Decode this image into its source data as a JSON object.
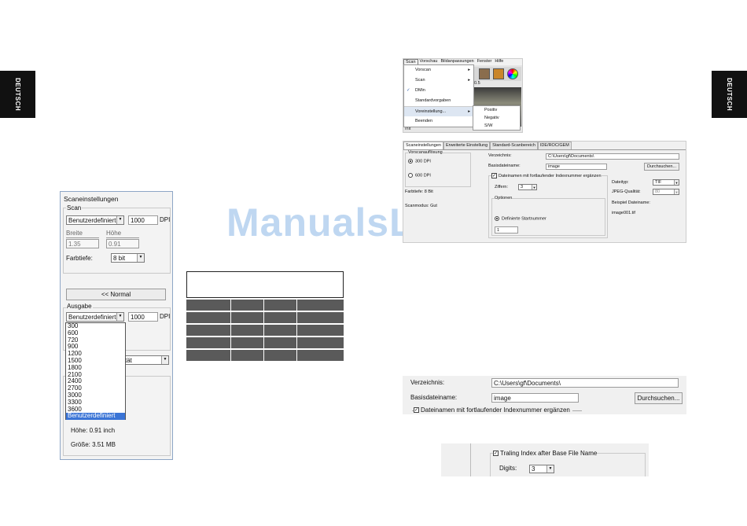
{
  "page": {
    "side_tab_label": "DEUTSCH",
    "watermark": "ManualsLib.de"
  },
  "scan_panel": {
    "title": "Scaneinstellungen",
    "scan_group": "Scan",
    "scan_res_select": "Benutzerdefiniert",
    "scan_res_value": "1000",
    "dpi": "DPI",
    "width_label": "Breite",
    "height_label": "Höhe",
    "width_value": "1.35",
    "height_value": "0.91",
    "depth_label": "Farbtiefe:",
    "depth_value": "8 bit",
    "normal_button": "<< Normal",
    "output_group": "Ausgabe",
    "out_res_select": "Benutzerdefiniert",
    "out_res_value": "1000",
    "quality_select_partial": "tät",
    "dropdown_options": [
      "300",
      "600",
      "720",
      "900",
      "1200",
      "1500",
      "1800",
      "2100",
      "2400",
      "2700",
      "3000",
      "3300",
      "3600",
      "Benutzerdefiniert"
    ],
    "selected_option": "Benutzerdefiniert",
    "size_height": "Höhe: 0.91 inch",
    "size_total": "Größe: 3.51 MB"
  },
  "menu_shot": {
    "menubar": [
      "Scan",
      "Vorschau",
      "Bildanpassungen",
      "Fenster",
      "Hilfe"
    ],
    "items": [
      "Vorscan",
      "Scan",
      "DMin",
      "Standardvorgaben",
      "Voreinstellung...",
      "Beenden"
    ],
    "submenu": [
      "Positiv",
      "Negativ",
      "S/W"
    ],
    "toolbar_value": "0.5",
    "status_text": "Init"
  },
  "settings_shot": {
    "tabs": [
      "Scaneinstellungen",
      "Erweiterte Einstellung",
      "Standard-Scanbereich",
      "IDE/ROC/GEM"
    ],
    "preview_res_label": "Vorscanauflösung",
    "radio_300": "300 DPI",
    "radio_600": "600 DPI",
    "depth_text": "Farbtiefe: 8 Bit",
    "scanmode_text": "Scanmodus: Gut",
    "folder_label": "Verzeichnis:",
    "folder_value": "C:\\Users\\gf\\Documents\\",
    "base_label": "Basisdateiname:",
    "base_value": "image",
    "browse_button": "Durchsuchen...",
    "index_checkbox": "Dateinamen mit fortlaufender Indexnummer ergänzen",
    "digits_label": "Ziffern:",
    "digits_value": "3",
    "options_label": "Optionen",
    "start_number": "Definierte Startnummer",
    "start_value": "1",
    "filetype_label": "Dateityp:",
    "filetype_value": "TIF",
    "jpeg_label": "JPEG-Qualität:",
    "jpeg_value": "80",
    "example_label": "Beispiel Dateiname:",
    "example_value": "image001.tif"
  },
  "crop1": {
    "folder_label": "Verzeichnis:",
    "folder_value": "C:\\Users\\gf\\Documents\\",
    "base_label": "Basisdateiname:",
    "base_value": "image",
    "browse_button": "Durchsuchen...",
    "index_checkbox": "Dateinamen mit fortlaufender Indexnummer ergänzen"
  },
  "crop2": {
    "checkbox_label": "Traling Index after Base File Name",
    "digits_label": "Digits:",
    "digits_value": "3"
  }
}
